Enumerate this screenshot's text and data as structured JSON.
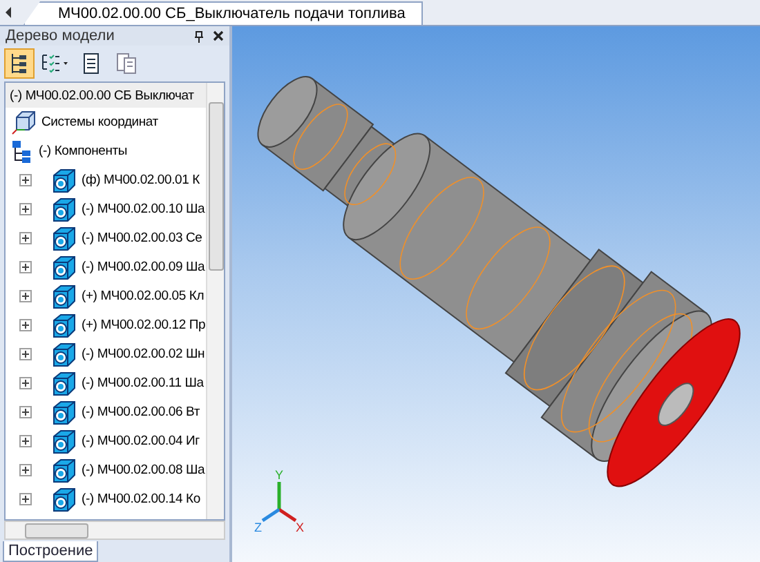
{
  "document_tab": {
    "label": "МЧ00.02.00.00 СБ_Выключатель подачи топлива",
    "selected": true
  },
  "panel": {
    "title": "Дерево модели",
    "bottom_tab": {
      "label": "Построение",
      "selected": true
    }
  },
  "toolbar": [
    {
      "kind": "tree",
      "selected": true
    },
    {
      "kind": "filter",
      "selected": false
    },
    {
      "kind": "page",
      "selected": false
    },
    {
      "kind": "pages",
      "selected": false
    }
  ],
  "tree": {
    "root": "(-) МЧ00.02.00.00 СБ Выключат",
    "items": [
      {
        "kind": "coords",
        "label": "Системы координат"
      },
      {
        "kind": "group",
        "label": "(-) Компоненты",
        "children": [
          {
            "label": "(ф) МЧ00.02.00.01 К",
            "expanded": false
          },
          {
            "label": "(-) МЧ00.02.00.10 Ша",
            "expanded": false
          },
          {
            "label": "(-) МЧ00.02.00.03 Се",
            "expanded": false
          },
          {
            "label": "(-) МЧ00.02.00.09 Ша",
            "expanded": false
          },
          {
            "label": "(+) МЧ00.02.00.05 Кл",
            "expanded": false
          },
          {
            "label": "(+) МЧ00.02.00.12 Пр",
            "expanded": false
          },
          {
            "label": "(-) МЧ00.02.00.02 Шн",
            "expanded": false
          },
          {
            "label": "(-) МЧ00.02.00.11 Ша",
            "expanded": false
          },
          {
            "label": "(-) МЧ00.02.00.06 Вт",
            "expanded": false
          },
          {
            "label": "(-) МЧ00.02.00.04 Иг",
            "expanded": false
          },
          {
            "label": "(-) МЧ00.02.00.08 Ша",
            "expanded": false
          },
          {
            "label": "(-) МЧ00.02.00.14 Ко",
            "expanded": false
          }
        ]
      }
    ]
  },
  "axes": {
    "x": "X",
    "y": "Y",
    "z": "Z"
  }
}
